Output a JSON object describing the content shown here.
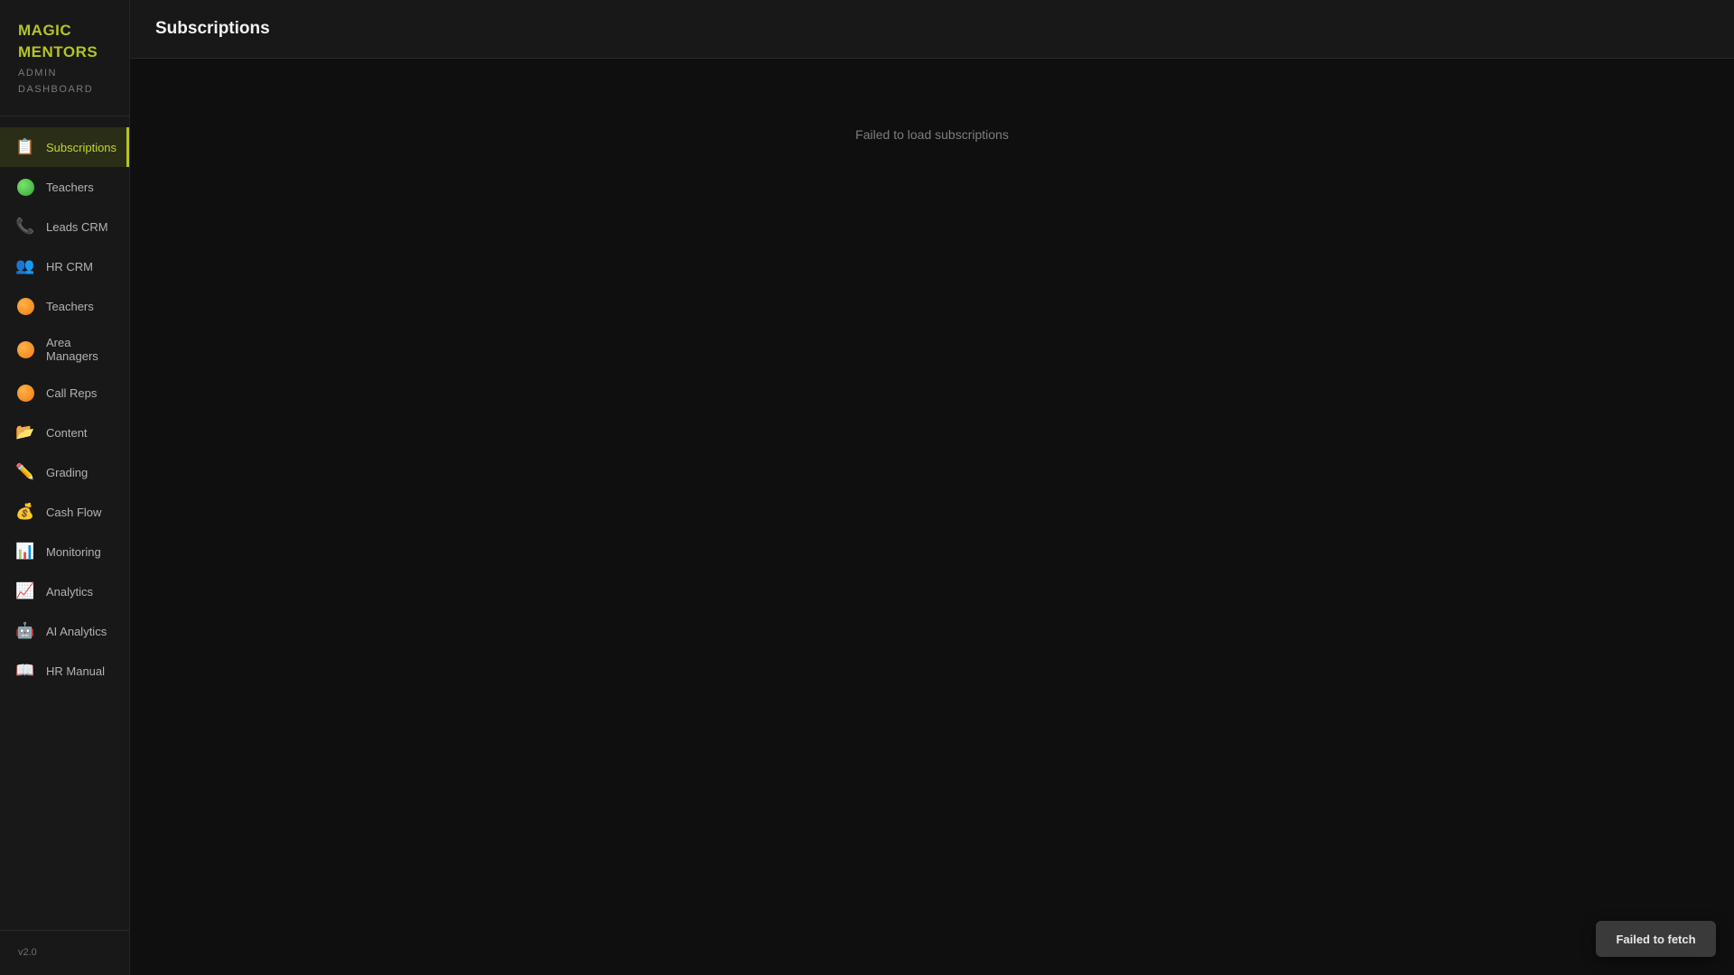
{
  "brand": {
    "title": "MAGIC MENTORS",
    "subtitle": "ADMIN DASHBOARD"
  },
  "sidebar": {
    "items": [
      {
        "label": "Subscriptions",
        "icon": "clipboard-icon",
        "active": true
      },
      {
        "label": "Teachers",
        "icon": "green-circle-icon"
      },
      {
        "label": "Leads CRM",
        "icon": "phone-icon"
      },
      {
        "label": "HR CRM",
        "icon": "people-icon"
      },
      {
        "label": "Teachers",
        "icon": "orange-circle-icon"
      },
      {
        "label": "Area Managers",
        "icon": "orange-circle-icon"
      },
      {
        "label": "Call Reps",
        "icon": "orange-circle-icon"
      },
      {
        "label": "Content",
        "icon": "folder-icon"
      },
      {
        "label": "Grading",
        "icon": "pencil-icon"
      },
      {
        "label": "Cash Flow",
        "icon": "money-bag-icon"
      },
      {
        "label": "Monitoring",
        "icon": "bar-chart-icon"
      },
      {
        "label": "Analytics",
        "icon": "line-chart-icon"
      },
      {
        "label": "AI Analytics",
        "icon": "robot-icon"
      },
      {
        "label": "HR Manual",
        "icon": "book-icon"
      }
    ],
    "version": "v2.0"
  },
  "header": {
    "title": "Subscriptions"
  },
  "main": {
    "error_message": "Failed to load subscriptions"
  },
  "toast": {
    "message": "Failed to fetch"
  },
  "colors": {
    "accent": "#b5c424",
    "active_bg": "#2b2e16",
    "sidebar_bg": "#181818",
    "main_bg": "#0f0f0f",
    "toast_bg": "#3a3a3a"
  }
}
